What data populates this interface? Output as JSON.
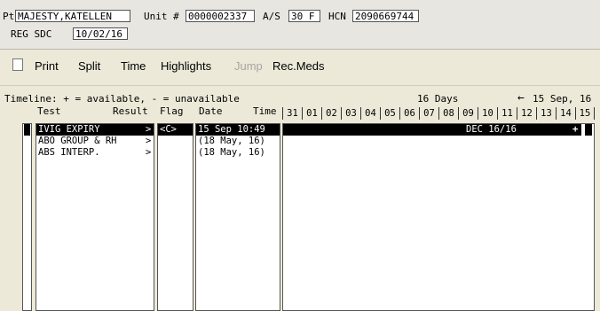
{
  "header": {
    "pt_label": "Pt",
    "patient_name": "MAJESTY,KATELLEN",
    "unit_label": "Unit #",
    "unit_number": "0000002337",
    "as_label": "A/S",
    "as_value": "30 F",
    "hcn_label": "HCN",
    "hcn_value": "2090669744",
    "reg_label": "REG SDC",
    "reg_date": "10/02/16"
  },
  "toolbar": {
    "print": "Print",
    "split": "Split",
    "time": "Time",
    "highlights": "Highlights",
    "jump": "Jump",
    "recmeds": "Rec.Meds"
  },
  "timeline": {
    "legend": "Timeline: + = available, - = unavailable",
    "days_label": "16 Days",
    "nav_arrow": "←",
    "range_start": "15 Sep, 16",
    "columns": {
      "test": "Test",
      "result": "Result",
      "flag": "Flag",
      "date": "Date",
      "time": "Time"
    },
    "days": [
      "31",
      "01",
      "02",
      "03",
      "04",
      "05",
      "06",
      "07",
      "08",
      "09",
      "10",
      "11",
      "12",
      "13",
      "14",
      "15"
    ],
    "rows": [
      {
        "test": "IVIG EXPIRY",
        "arrow": ">",
        "flag": "<C>",
        "date": "15 Sep 10:49",
        "bar_text": "DEC 16/16",
        "marker": "+"
      },
      {
        "test": "ABO GROUP & RH",
        "arrow": ">",
        "flag": "",
        "date": "(18 May, 16)",
        "bar_text": "",
        "marker": ""
      },
      {
        "test": "ABS INTERP.",
        "arrow": ">",
        "flag": "",
        "date": "(18 May, 16)",
        "bar_text": "",
        "marker": ""
      }
    ]
  }
}
